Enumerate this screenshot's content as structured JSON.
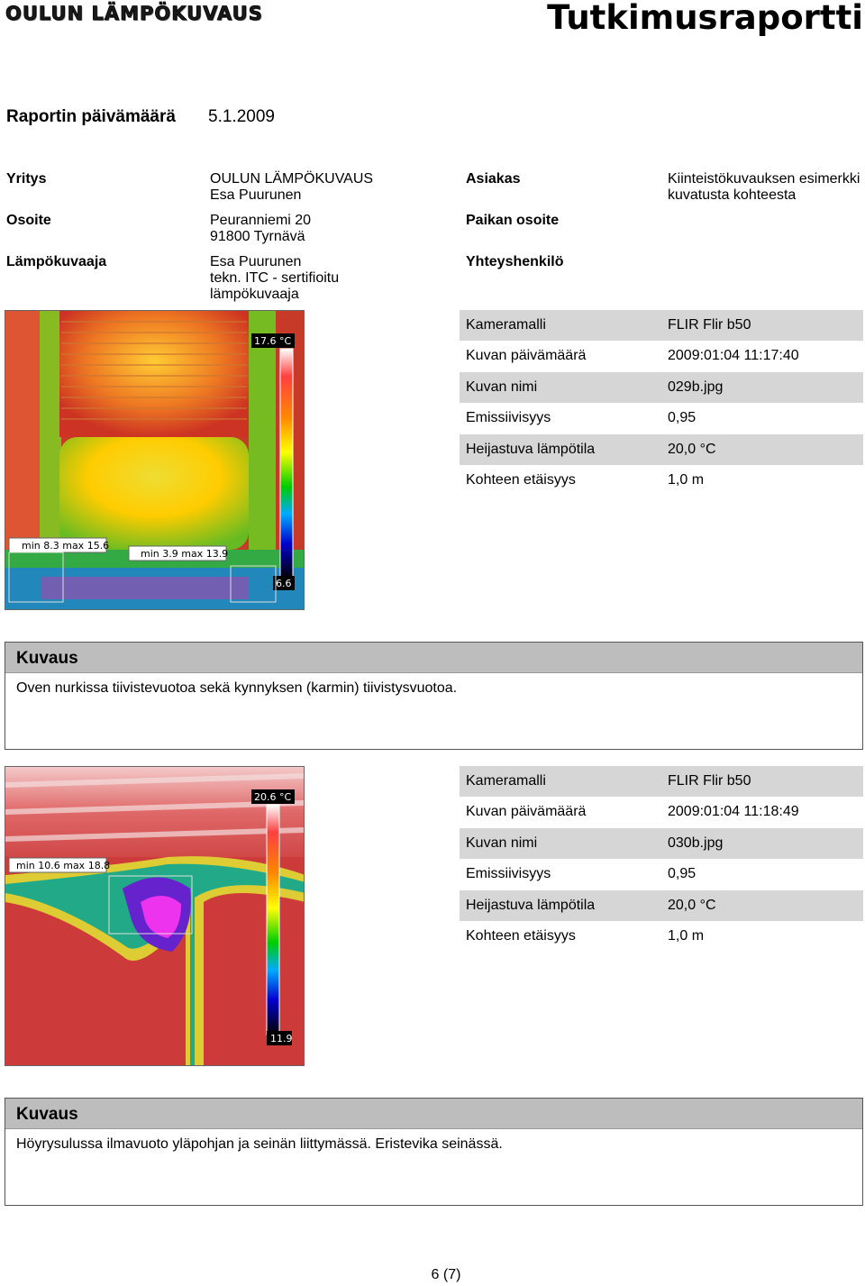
{
  "header": {
    "logo_text": "OULUN LÄMPÖKUVAUS",
    "title": "Tutkimusraportti"
  },
  "report_date": {
    "label": "Raportin päivämäärä",
    "value": "5.1.2009"
  },
  "company": {
    "label": "Yritys",
    "line1": "OULUN LÄMPÖKUVAUS",
    "line2": "Esa Puurunen"
  },
  "address": {
    "label": "Osoite",
    "line1": "Peuranniemi 20",
    "line2": "91800 Tyrnävä"
  },
  "imager": {
    "label": "Lämpökuvaaja",
    "line1": "Esa Puurunen",
    "line2": "tekn. ITC - sertifioitu",
    "line3": "lämpökuvaaja"
  },
  "client": {
    "label": "Asiakas",
    "line1": "Kiinteistökuvauksen esimerkki",
    "line2": "kuvatusta kohteesta"
  },
  "site_address": {
    "label": "Paikan osoite"
  },
  "contact": {
    "label": "Yhteyshenkilö"
  },
  "records": [
    {
      "image": {
        "scale_max": "17.6 °C",
        "scale_min": "6.6",
        "box1": "min 8.3 max 15.6",
        "box2": "min 3.9 max 13.9"
      },
      "meta": [
        {
          "key": "Kameramalli",
          "value": "FLIR Flir b50"
        },
        {
          "key": "Kuvan päivämäärä",
          "value": "2009:01:04 11:17:40"
        },
        {
          "key": "Kuvan nimi",
          "value": "029b.jpg"
        },
        {
          "key": "Emissiivisyys",
          "value": "0,95"
        },
        {
          "key": "Heijastuva lämpötila",
          "value": "20,0 °C"
        },
        {
          "key": "Kohteen etäisyys",
          "value": "1,0 m"
        }
      ],
      "desc_title": "Kuvaus",
      "desc_text": "Oven nurkissa tiivistevuotoa sekä kynnyksen (karmin)  tiivistysvuotoa."
    },
    {
      "image": {
        "scale_max": "20.6 °C",
        "scale_min": "11.9",
        "box1": "min 10.6 max 18.8"
      },
      "meta": [
        {
          "key": "Kameramalli",
          "value": "FLIR Flir b50"
        },
        {
          "key": "Kuvan päivämäärä",
          "value": "2009:01:04 11:18:49"
        },
        {
          "key": "Kuvan nimi",
          "value": "030b.jpg"
        },
        {
          "key": "Emissiivisyys",
          "value": "0,95"
        },
        {
          "key": "Heijastuva lämpötila",
          "value": "20,0 °C"
        },
        {
          "key": "Kohteen etäisyys",
          "value": "1,0 m"
        }
      ],
      "desc_title": "Kuvaus",
      "desc_text": "Höyrysulussa ilmavuoto yläpohjan ja seinän liittymässä. Eristevika seinässä."
    }
  ],
  "footer": {
    "page": "6  (7)"
  }
}
